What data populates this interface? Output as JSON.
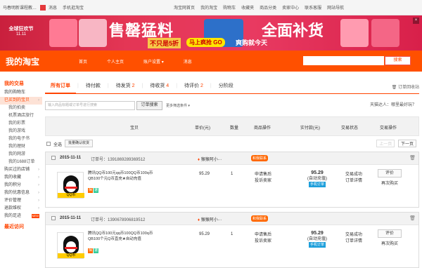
{
  "topbar": {
    "items": [
      "马春明新课程教…",
      "消息",
      "手机逛淘宝",
      "淘宝网首页",
      "我的淘宝",
      "购物车",
      "收藏夹",
      "商品分类",
      "卖家中心",
      "联系客服",
      "网站导航"
    ],
    "active_index": 3
  },
  "banner": {
    "logo_line1": "全球狂欢节",
    "logo_line2": "11.11",
    "headline_left": "售罄猛料",
    "sub1": "不只是5折",
    "sub2": "马上疯抢 GO",
    "sub3": "爽购就今天",
    "headline_right": "全面补货",
    "close_label": "×"
  },
  "nav": {
    "brand": "我的淘宝",
    "links": [
      "首页",
      "个人主页",
      "账户设置",
      "消息"
    ],
    "search_button": "搜索"
  },
  "sidebar": {
    "section_trade": "我的交易",
    "items": [
      {
        "label": "我的购物车",
        "sub": false,
        "active": false
      },
      {
        "label": "已买到的宝贝",
        "sub": false,
        "active": true
      },
      {
        "label": "我的拍卖",
        "sub": true,
        "active": false
      },
      {
        "label": "机票酒店旅行",
        "sub": true,
        "active": false
      },
      {
        "label": "我的彩票",
        "sub": true,
        "active": false
      },
      {
        "label": "我的游戏",
        "sub": true,
        "active": false
      },
      {
        "label": "我的电子书",
        "sub": true,
        "active": false
      },
      {
        "label": "我的理财",
        "sub": true,
        "active": false
      },
      {
        "label": "我的网游",
        "sub": true,
        "active": false
      },
      {
        "label": "我的1688订单",
        "sub": true,
        "active": false
      },
      {
        "label": "购买过的店铺",
        "sub": false,
        "active": false
      },
      {
        "label": "我的收藏",
        "sub": false,
        "active": false
      },
      {
        "label": "我的积分",
        "sub": false,
        "active": false
      },
      {
        "label": "我的优惠信息",
        "sub": false,
        "active": false
      },
      {
        "label": "评价管理",
        "sub": false,
        "active": false
      },
      {
        "label": "退款维权",
        "sub": false,
        "active": false
      },
      {
        "label": "我的足迹",
        "sub": false,
        "active": false
      }
    ],
    "section_recent": "最近访问",
    "new_badge": "NEW"
  },
  "tabs": {
    "items": [
      {
        "label": "所有订单",
        "count": "",
        "active": true
      },
      {
        "label": "待付款",
        "count": "",
        "active": false
      },
      {
        "label": "待发货",
        "count": "2",
        "active": false
      },
      {
        "label": "待收货",
        "count": "4",
        "active": false
      },
      {
        "label": "待评价",
        "count": "2",
        "active": false
      },
      {
        "label": "分阶段",
        "count": "",
        "active": false
      }
    ],
    "trash": "订单回收站"
  },
  "search": {
    "placeholder": "输入商品标题或订单号进行搜索",
    "button": "订单搜索",
    "more": "更多筛选条件",
    "alert": "天猫达人：哪里最好玩？"
  },
  "table": {
    "headers": [
      "宝贝",
      "单价(元)",
      "数量",
      "商品操作",
      "实付款(元)",
      "交易状态",
      "交易操作"
    ],
    "select_all": "全选",
    "bulk_confirm": "批量确认收货",
    "prev": "上一页",
    "next": "下一页"
  },
  "orders": [
    {
      "date": "2015-11-11",
      "order_no": "订单号：1391869289369512",
      "shop": "猴猴阿小···",
      "chat": "和我联系",
      "title": "腾讯QQ币100元qq币100QQ币100q币QB100个元Q币直充★自动充值",
      "thumb_tag": "QQ币",
      "price": "95.29",
      "qty": "1",
      "after_sale": [
        "申请售后",
        "投诉卖家"
      ],
      "paid": "95.29",
      "paid_note": "(自动充值)",
      "pay_method": "手机订单",
      "status": [
        "交易成功",
        "订单详情"
      ],
      "action_btn": "评价",
      "action_link": "再次购买"
    },
    {
      "date": "2015-11-11",
      "order_no": "订单号：1390678906819512",
      "shop": "猴猴阿小···",
      "chat": "和我联系",
      "title": "腾讯QQ币100元qq币100QQ币100q币QB100个元Q币直充★自动充值",
      "thumb_tag": "QQ币",
      "price": "95.29",
      "qty": "1",
      "after_sale": [
        "申请售后",
        "投诉卖家"
      ],
      "paid": "95.29",
      "paid_note": "(自动充值)",
      "pay_method": "手机订单",
      "status": [
        "交易成功",
        "订单详情"
      ],
      "action_btn": "评价",
      "action_link": "再次购买"
    }
  ],
  "colors": {
    "accent": "#ff5000",
    "banner": "#e43655"
  }
}
